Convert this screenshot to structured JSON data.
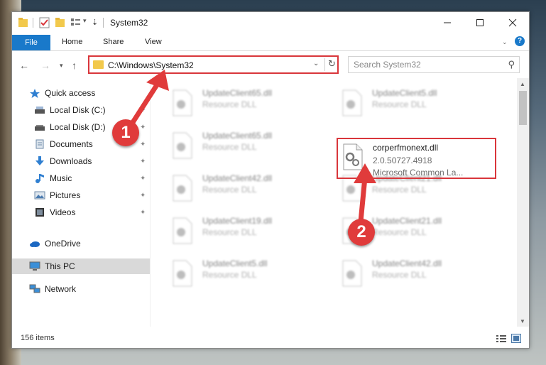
{
  "window": {
    "title": "System32",
    "controls": [
      "minimize-icon",
      "maximize-icon",
      "close-icon"
    ]
  },
  "ribbon": {
    "tabs": [
      "File",
      "Home",
      "Share",
      "View"
    ],
    "help_label": "?"
  },
  "address": {
    "path": "C:\\Windows\\System32",
    "search_placeholder": "Search System32"
  },
  "sidebar": {
    "items": [
      {
        "label": "Quick access",
        "icon": "star-icon",
        "pinned": false
      },
      {
        "label": "Local Disk (C:)",
        "icon": "drive-icon",
        "pinned": true
      },
      {
        "label": "Local Disk (D:)",
        "icon": "drive-icon",
        "pinned": true
      },
      {
        "label": "Documents",
        "icon": "documents-icon",
        "pinned": true
      },
      {
        "label": "Downloads",
        "icon": "download-icon",
        "pinned": true
      },
      {
        "label": "Music",
        "icon": "music-icon",
        "pinned": true
      },
      {
        "label": "Pictures",
        "icon": "pictures-icon",
        "pinned": true
      },
      {
        "label": "Videos",
        "icon": "videos-icon",
        "pinned": true
      },
      {
        "label": "OneDrive",
        "icon": "cloud-icon",
        "pinned": false
      },
      {
        "label": "This PC",
        "icon": "computer-icon",
        "pinned": false,
        "selected": true
      },
      {
        "label": "Network",
        "icon": "network-icon",
        "pinned": false
      }
    ]
  },
  "files": [
    {
      "name": "UpdateClient65.dll",
      "sub": "Resource DLL",
      "blurred": true
    },
    {
      "name": "UpdateClient5.dll",
      "sub": "Resource DLL",
      "blurred": true
    },
    {
      "name": "UpdateClient65.dll",
      "sub": "Resource DLL",
      "blurred": true
    },
    {
      "name": "corperfmonext.dll",
      "version": "2.0.50727.4918",
      "sub": "Microsoft Common La...",
      "blurred": false
    },
    {
      "name": "UpdateClient42.dll",
      "sub": "Resource DLL",
      "blurred": true
    },
    {
      "name": "UpdateClient21.dll",
      "sub": "Resource DLL",
      "blurred": true
    },
    {
      "name": "UpdateClient19.dll",
      "sub": "Resource DLL",
      "blurred": true
    },
    {
      "name": "UpdateClient21.dll",
      "sub": "Resource DLL",
      "blurred": true
    },
    {
      "name": "UpdateClient5.dll",
      "sub": "Resource DLL",
      "blurred": true
    },
    {
      "name": "UpdateClient42.dll",
      "sub": "Resource DLL",
      "blurred": true
    }
  ],
  "status": {
    "item_count": "156 items"
  },
  "callouts": [
    "1",
    "2"
  ],
  "colors": {
    "accent": "#1979ca",
    "callout": "#e03b3b",
    "highlight_border": "#d9363b"
  }
}
